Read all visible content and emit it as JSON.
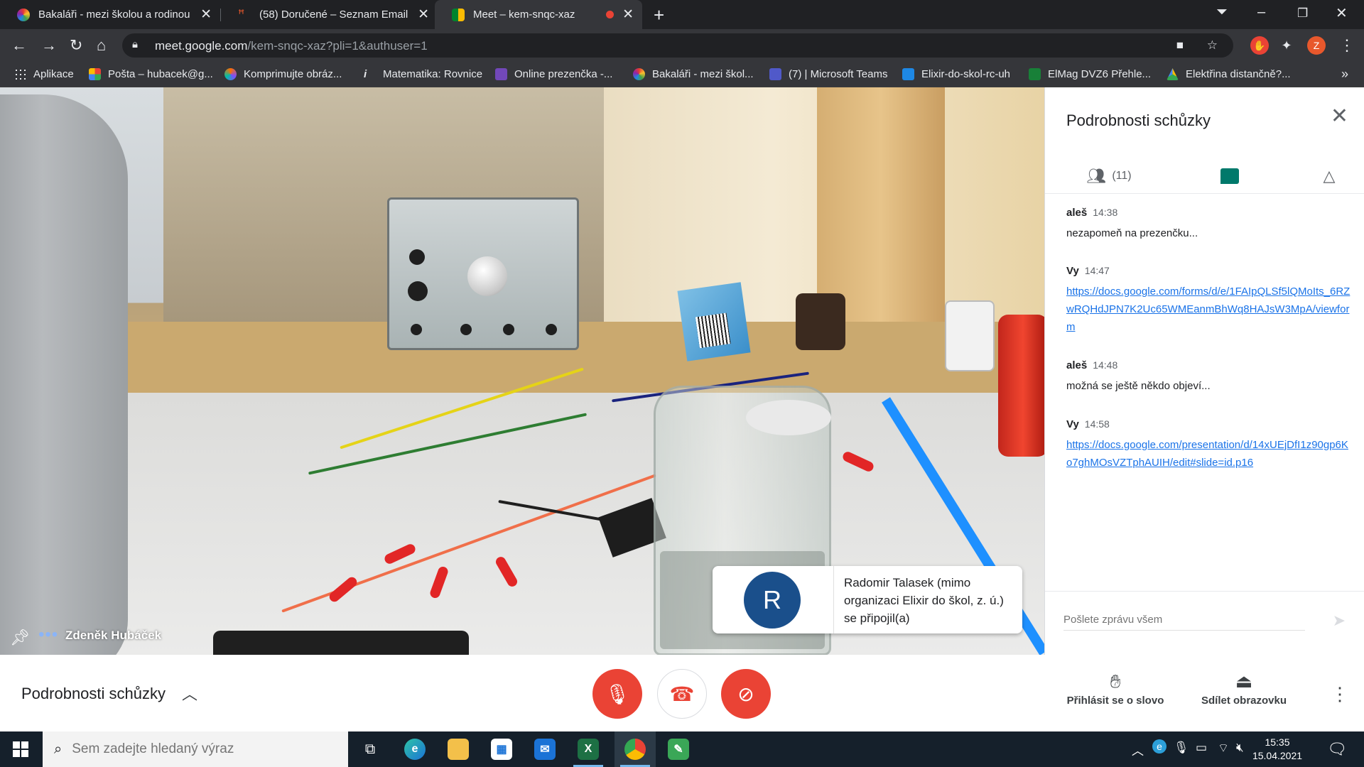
{
  "browser": {
    "tabs": [
      {
        "title": "Bakaláři - mezi školou a rodinou",
        "active": false
      },
      {
        "title": "(58) Doručené – Seznam Email",
        "active": false
      },
      {
        "title": "Meet – kem-snqc-xaz",
        "active": true
      }
    ],
    "url_host": "meet.google.com",
    "url_path": "/kem-snqc-xaz?pli=1&authuser=1",
    "profile_initial": "Z",
    "bookmarks": [
      "Aplikace",
      "Pošta – hubacek@g...",
      "Komprimujte obráz...",
      "Matematika: Rovnice",
      "Online prezenčka -...",
      "Bakaláři - mezi škol...",
      "(7) | Microsoft Teams",
      "Elixir-do-skol-rc-uh",
      "ElMag DVZ6 Přehle...",
      "Elektřina distančně?..."
    ],
    "bookmarks_more": "»"
  },
  "meet": {
    "participant_name": "Zdeněk Hubáček",
    "toast": {
      "avatar_letter": "R",
      "text": "Radomir Talasek (mimo organizaci Elixir do škol, z. ú.) se připojil(a)"
    },
    "panel": {
      "title": "Podrobnosti schůzky",
      "people_count": "(11)",
      "messages": [
        {
          "sender": "aleš",
          "time": "14:38",
          "text": "nezapomeň na prezenčku...",
          "link": false
        },
        {
          "sender": "Vy",
          "time": "14:47",
          "text": "https://docs.google.com/forms/d/e/1FAIpQLSf5lQMoIts_6RZwRQHdJPN7K2Uc65WMEanmBhWq8HAJsW3MpA/viewform",
          "link": true
        },
        {
          "sender": "aleš",
          "time": "14:48",
          "text": "možná se ještě někdo objeví...",
          "link": false
        },
        {
          "sender": "Vy",
          "time": "14:58",
          "text": "https://docs.google.com/presentation/d/14xUEjDfI1z90gp6Ko7ghMOsVZTphAUIH/edit#slide=id.p16",
          "link": true
        }
      ],
      "composer_placeholder": "Pošlete zprávu všem"
    },
    "controls": {
      "details_label": "Podrobnosti schůzky",
      "raise_hand": "Přihlásit se o slovo",
      "present": "Sdílet obrazovku"
    }
  },
  "taskbar": {
    "search_placeholder": "Sem zadejte hledaný výraz",
    "time": "15:35",
    "date": "15.04.2021"
  },
  "colors": {
    "red": "#ea4335",
    "teal": "#00796b",
    "link": "#1a73e8",
    "avatar": "#1a4f8b"
  }
}
